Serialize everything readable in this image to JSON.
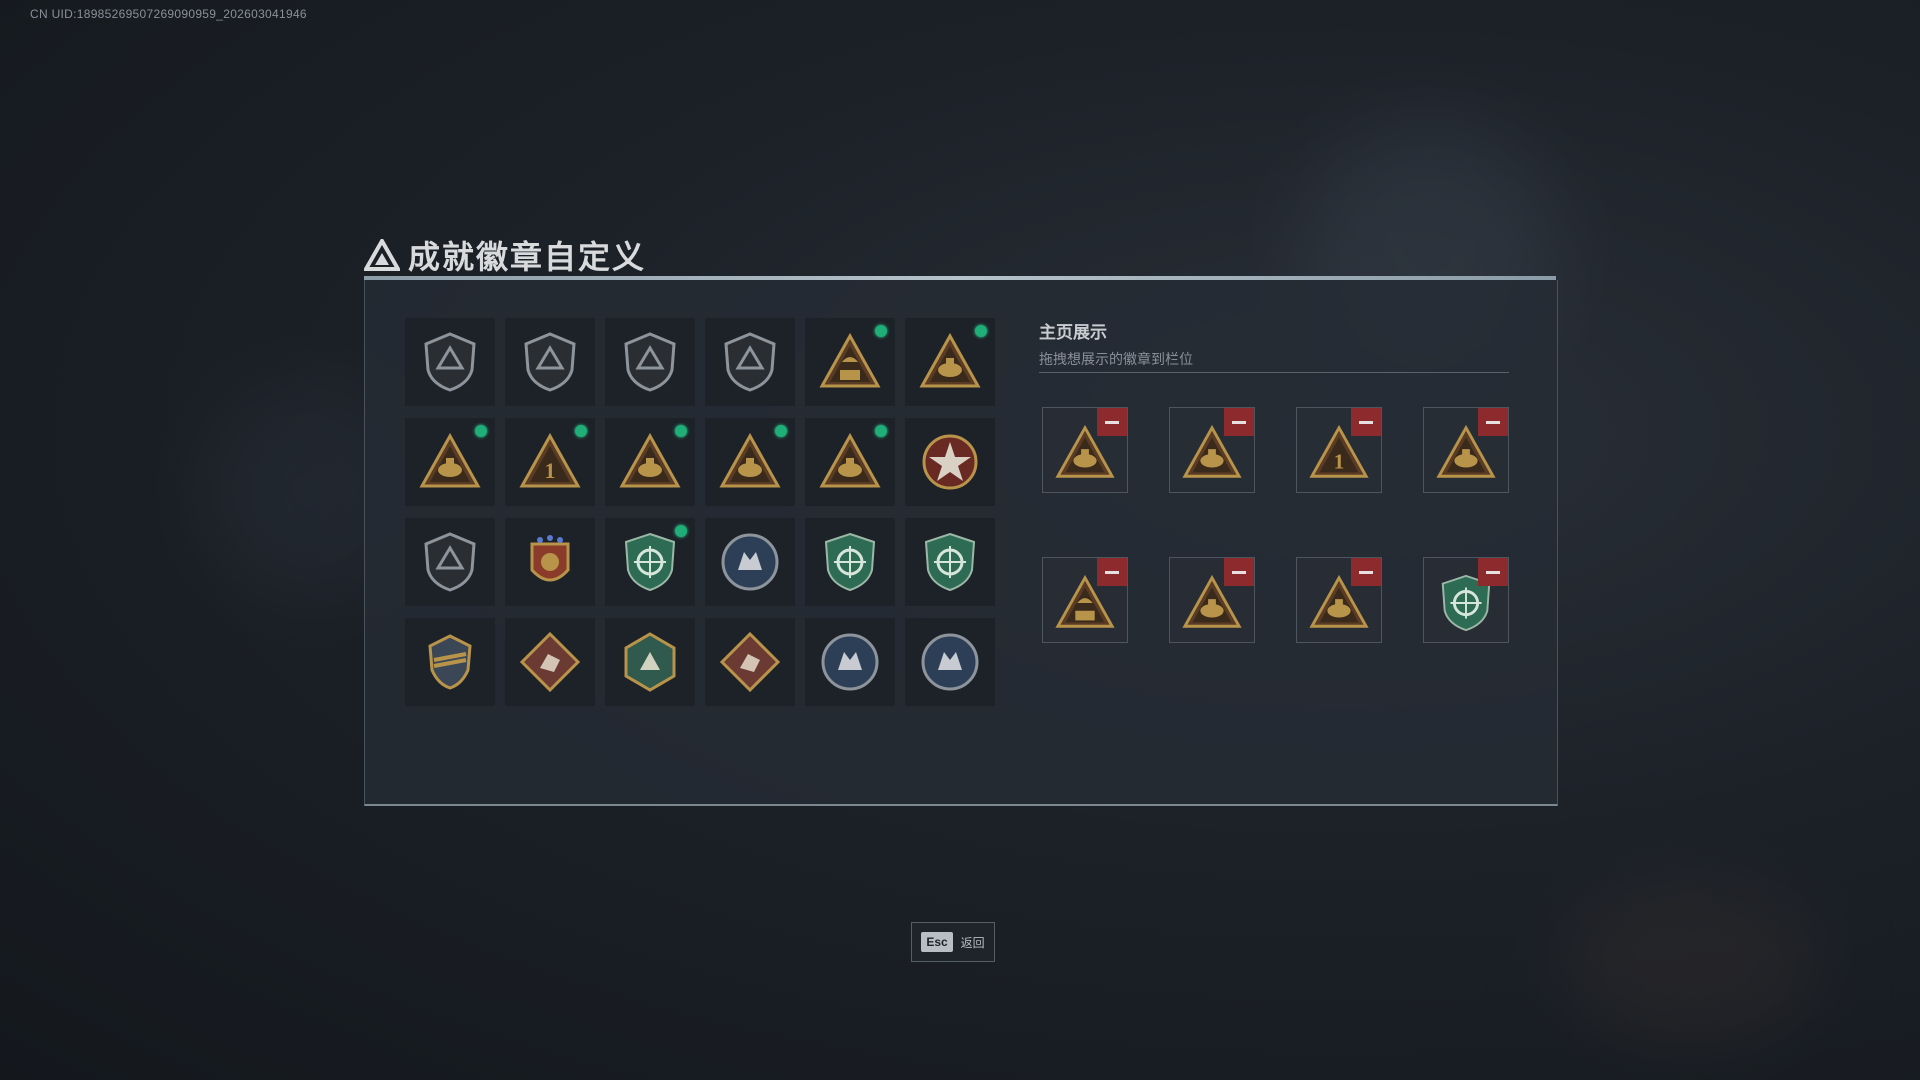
{
  "uid_text": "CN UID:18985269507269090959_202603041946",
  "title": "成就徽章自定义",
  "display": {
    "title": "主页展示",
    "subtitle": "拖拽想展示的徽章到栏位"
  },
  "escape": {
    "key": "Esc",
    "label": "返回"
  },
  "colors": {
    "new_dot": "#1fae78",
    "remove": "#8c2a2e",
    "gold": "#b8934a"
  },
  "badges": [
    {
      "icon": "shield-triangle-icon",
      "new": false
    },
    {
      "icon": "shield-helicopter-icon",
      "new": false
    },
    {
      "icon": "shield-diamond-icon",
      "new": false
    },
    {
      "icon": "shield-arrow-icon",
      "new": false
    },
    {
      "icon": "triangle-56-icon",
      "new": true
    },
    {
      "icon": "triangle-hat-icon",
      "new": true
    },
    {
      "icon": "triangle-tank-icon",
      "new": true
    },
    {
      "icon": "triangle-number-one-icon",
      "new": true
    },
    {
      "icon": "triangle-crate-icon",
      "new": true
    },
    {
      "icon": "triangle-skull-icon",
      "new": true
    },
    {
      "icon": "triangle-soldiers-icon",
      "new": true
    },
    {
      "icon": "star-medal-icon",
      "new": false
    },
    {
      "icon": "shield-emblem-icon",
      "new": false
    },
    {
      "icon": "stars-crest-icon",
      "new": false
    },
    {
      "icon": "green-shield-icon",
      "new": true
    },
    {
      "icon": "round-skull-icon",
      "new": false
    },
    {
      "icon": "green-crosshair-shield-icon",
      "new": false
    },
    {
      "icon": "green-crosshair-shield-alt-icon",
      "new": false
    },
    {
      "icon": "gold-wing-crest-icon",
      "new": false
    },
    {
      "icon": "diamond-beast-icon",
      "new": false
    },
    {
      "icon": "hex-insect-icon",
      "new": false
    },
    {
      "icon": "diamond-runner-icon",
      "new": false
    },
    {
      "icon": "round-wolf-icon",
      "new": false
    },
    {
      "icon": "round-wolf-alt-icon",
      "new": false
    }
  ],
  "slots": [
    {
      "icon": "triangle-hat-icon"
    },
    {
      "icon": "triangle-crate-icon"
    },
    {
      "icon": "triangle-number-one-icon"
    },
    {
      "icon": "triangle-tank-icon"
    },
    {
      "icon": "triangle-56-icon"
    },
    {
      "icon": "triangle-skull-icon"
    },
    {
      "icon": "triangle-soldiers-icon"
    },
    {
      "icon": "green-shield-icon"
    }
  ]
}
